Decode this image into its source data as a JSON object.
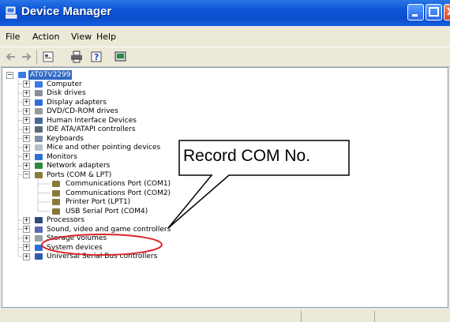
{
  "window": {
    "title": "Device Manager",
    "accent": "#0a4dc9",
    "controls": [
      "minimize",
      "maximize",
      "close"
    ]
  },
  "menu": [
    "File",
    "Action",
    "View",
    "Help"
  ],
  "toolbar_icons": [
    "back-arrow-icon",
    "forward-arrow-icon",
    "properties-icon",
    "print-icon",
    "help-icon",
    "scan-hardware-icon"
  ],
  "tree": {
    "root": "AT07V2299",
    "items": [
      "Computer",
      "Disk drives",
      "Display adapters",
      "DVD/CD-ROM drives",
      "Human Interface Devices",
      "IDE ATA/ATAPI controllers",
      "Keyboards",
      "Mice and other pointing devices",
      "Monitors",
      "Network adapters",
      "Ports (COM & LPT)",
      "Processors",
      "Sound, video and game controllers",
      "Storage volumes",
      "System devices",
      "Universal Serial Bus controllers"
    ],
    "ports_children": [
      "Communications Port (COM1)",
      "Communications Port (COM2)",
      "Printer Port (LPT1)",
      "USB Serial Port (COM4)"
    ]
  },
  "annotation": {
    "callout_text": "Record COM No.",
    "highlight_color": "#d9262a"
  }
}
